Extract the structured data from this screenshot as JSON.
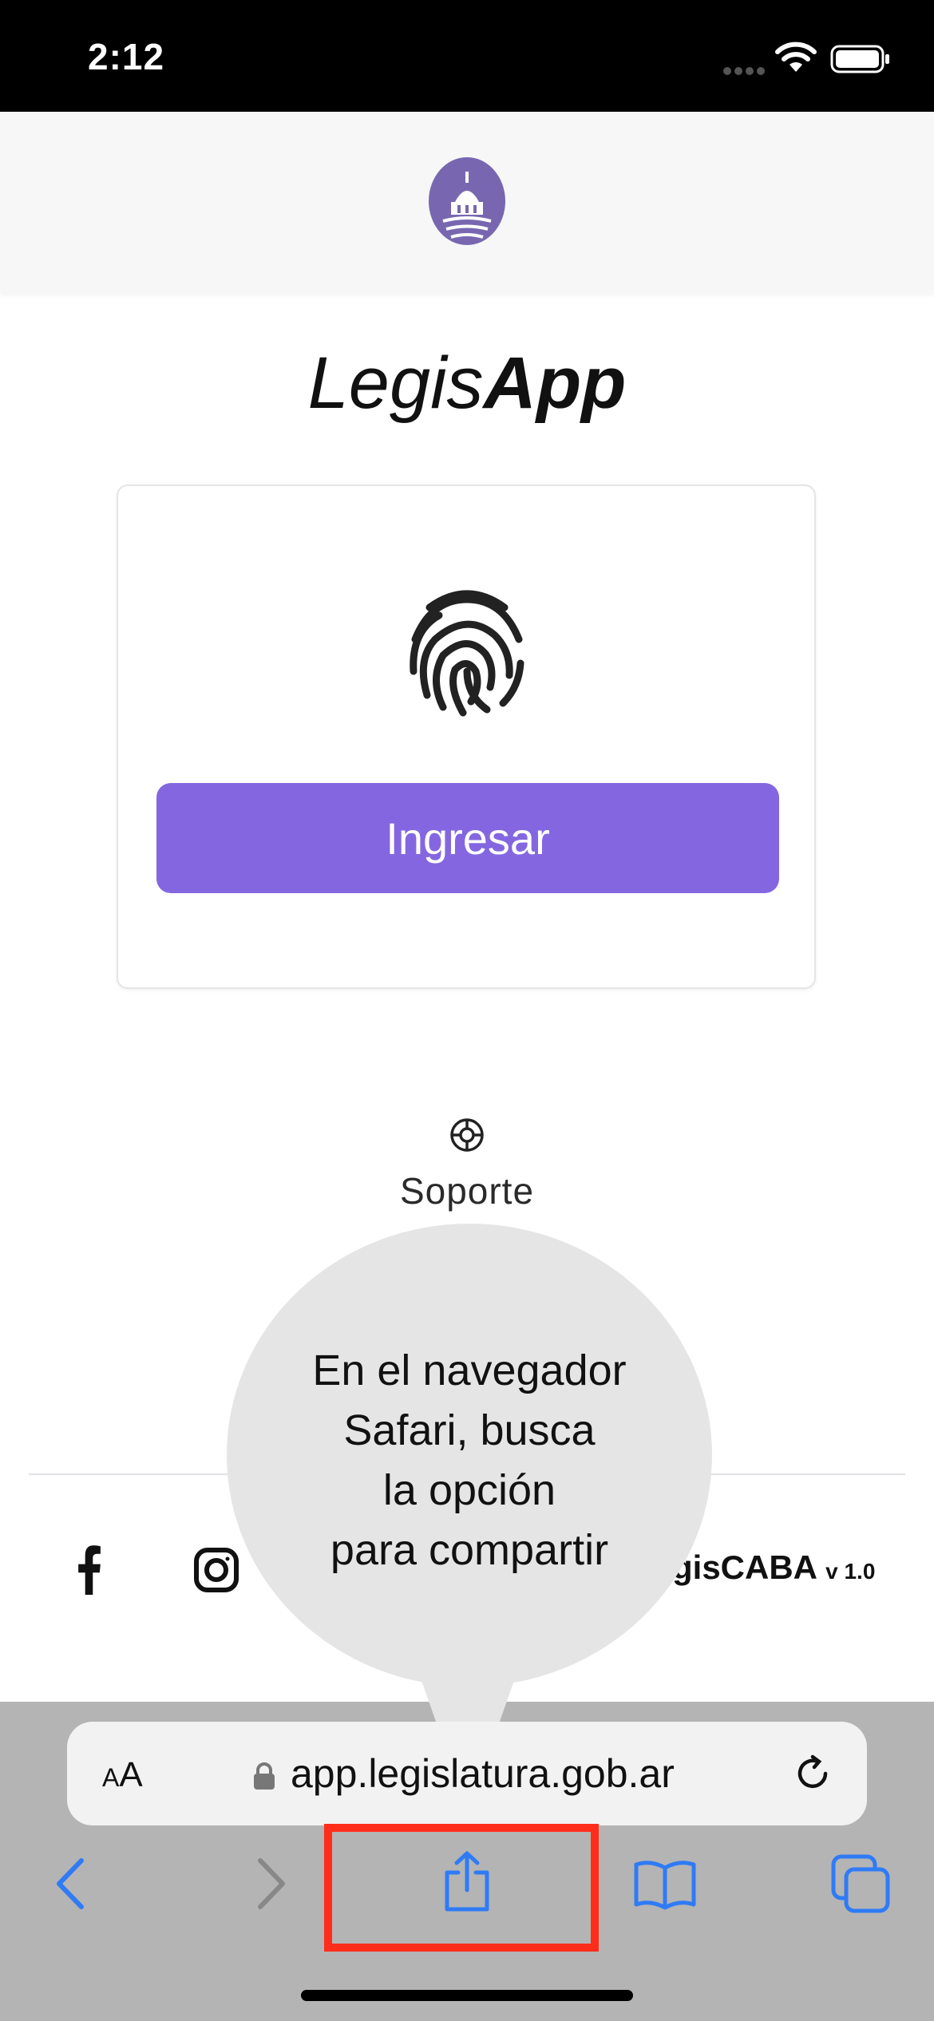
{
  "status_bar": {
    "time": "2:12"
  },
  "app": {
    "brand_light": "Legis",
    "brand_bold": "App",
    "login_label": "Ingresar",
    "support_label": "Soporte"
  },
  "footer": {
    "brand_partial": "gisCABA",
    "version": "v 1.0"
  },
  "tooltip": {
    "text": "En el navegador\nSafari, busca\nla opción\npara compartir"
  },
  "safari": {
    "text_size_label_small": "A",
    "text_size_label_large": "A",
    "url": "app.legislatura.gob.ar"
  },
  "colors": {
    "accent": "#8467e0",
    "highlight": "#ff2d1a",
    "ios_blue": "#2f7bf5"
  },
  "icons": [
    "signal-icon",
    "wifi-icon",
    "battery-icon",
    "legislature-logo",
    "fingerprint-icon",
    "support-icon",
    "facebook-icon",
    "instagram-icon",
    "lock-icon",
    "reload-icon",
    "back-icon",
    "forward-icon",
    "share-icon",
    "bookmarks-icon",
    "tabs-icon"
  ]
}
